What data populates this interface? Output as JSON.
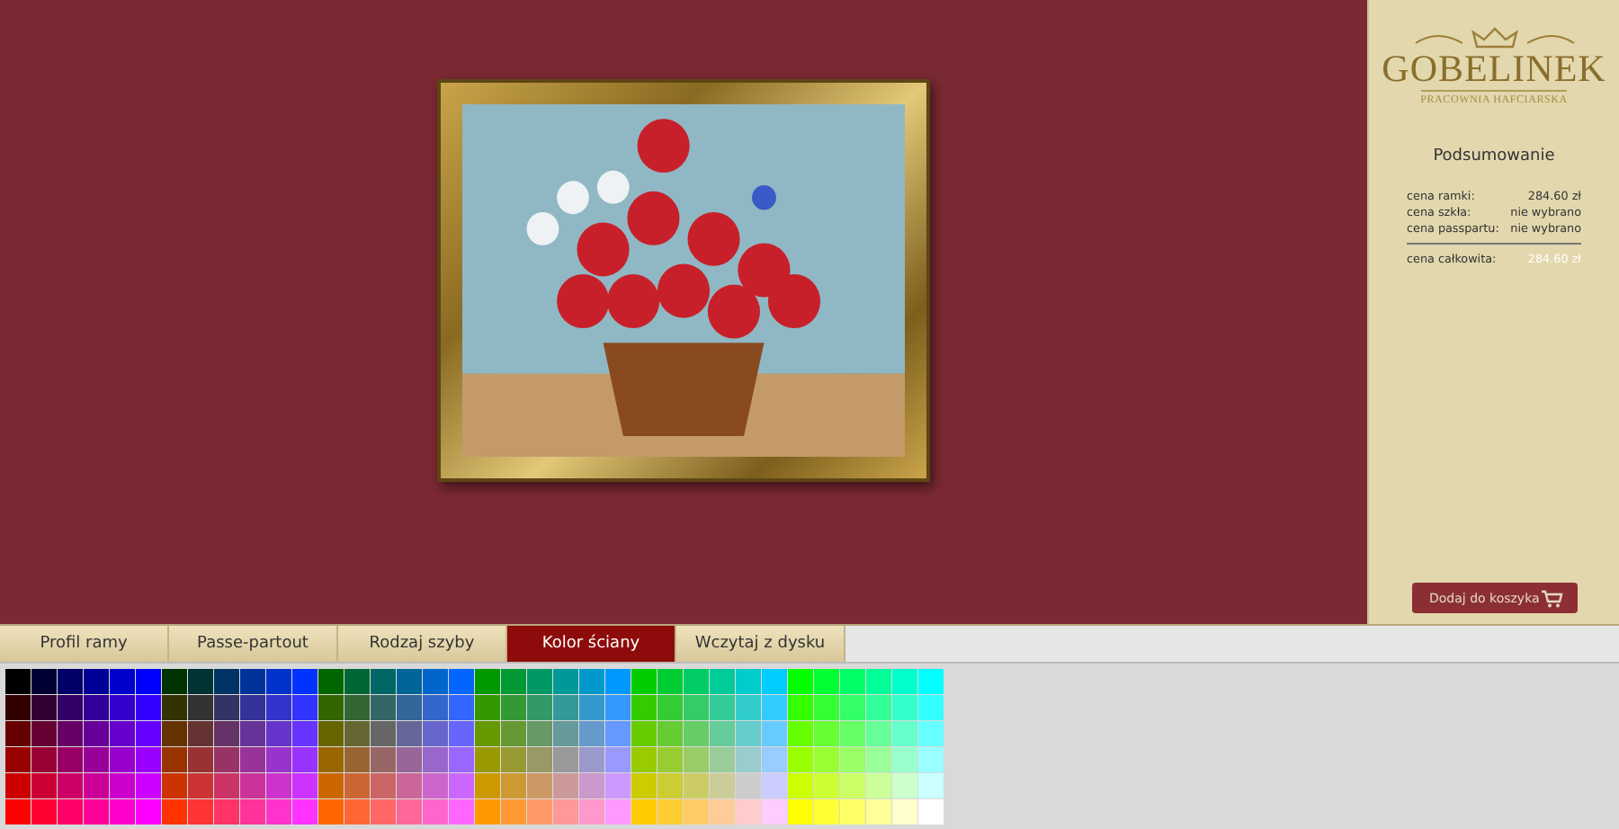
{
  "logo": {
    "name": "GOBELINEK",
    "subtitle": "PRACOWNIA HAFCIARSKA"
  },
  "summary": {
    "title": "Podsumowanie",
    "rows": [
      {
        "label": "cena ramki:",
        "value": "284.60 zł"
      },
      {
        "label": "cena szkła:",
        "value": "nie wybrano"
      },
      {
        "label": "cena passpartu:",
        "value": "nie wybrano"
      }
    ],
    "total": {
      "label": "cena całkowita:",
      "value": "284.60 zł"
    }
  },
  "cart_button": {
    "label": "Dodaj do koszyka"
  },
  "tabs": [
    {
      "label": "Profil ramy",
      "selected": false
    },
    {
      "label": "Passe-partout",
      "selected": false
    },
    {
      "label": "Rodzaj szyby",
      "selected": false
    },
    {
      "label": "Kolor ściany",
      "selected": true
    },
    {
      "label": "Wczytaj z dysku",
      "selected": false
    }
  ]
}
